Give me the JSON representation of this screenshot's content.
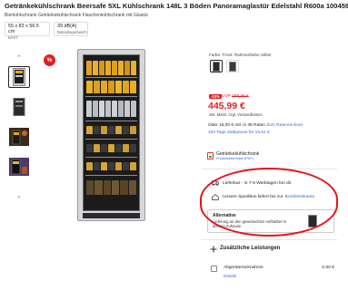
{
  "product": {
    "title": "Getränkekühlschrank Beersafe 5XL Kühlschrank 148L 3 Böden Panoramaglastür Edelstahl R600a 10045900",
    "subtitle": "Bierkühlschrank Getränkekühlschrank Flaschenkühlschrank mit Glastür"
  },
  "specs": [
    {
      "value": "55 x 83 x 56.5 cm",
      "label": "B/H/T"
    },
    {
      "value": "39 dB(A)",
      "label": "Betriebsgeräusch"
    }
  ],
  "gallery": {
    "sale_badge": "%",
    "nav_down": "⌄",
    "nav_up": "⌃"
  },
  "variant": {
    "color_label": "Farbe: Front: Rahmenfarbe Silber"
  },
  "pricing": {
    "discount_badge": "-10%",
    "uvp_label": "UVP",
    "uvp_value": "498,99 €",
    "price": "445,99 €",
    "vat_note": "inkl. MwSt. zzgl. Versandkosten",
    "finance_prefix": "Oder 16,00 € mtl. in 36 Raten",
    "finance_link": "Zum Ratenrechner",
    "payment_link": "100 Tage Zahlpause für 15,61 €"
  },
  "category": {
    "name": "Getränkekühlschrank",
    "sheet_link": "Produktdatenblatt (PDF)"
  },
  "delivery": {
    "time_prefix": "Lieferbar - in 7-9 Werktagen bei dir",
    "carrier_text": "Unsere Spedition liefert bis zur",
    "carrier_link": "Bordsteinkante",
    "alt_title": "Alternative",
    "alt_desc": "Lieferung an den gewünschten Aufstellort in deinem Zuhause",
    "alt_arrow": "›"
  },
  "extras": {
    "heading": "Zusätzliche Leistungen",
    "services": [
      {
        "name": "Altgeräterücknahme",
        "price": "0,00 €",
        "details": "Details"
      }
    ]
  },
  "colors": {
    "accent_red": "#e02020",
    "link_blue": "#2d6bd6",
    "ring_red": "#e5141b"
  }
}
